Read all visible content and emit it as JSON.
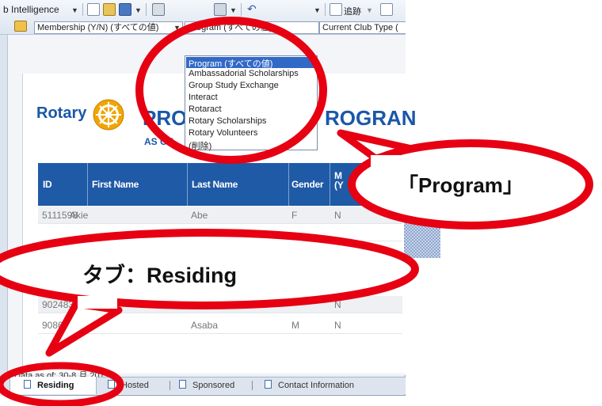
{
  "toolbar": {
    "app_menu_label": "b Intelligence",
    "track_label": "追跡",
    "filters": {
      "membership": "Membership (Y/N) (すべての値)",
      "program": "Program (すべての値)",
      "club_type": "Current Club Type ("
    }
  },
  "dropdown": {
    "options": [
      "Program (すべての値)",
      "Ambassadorial Scholarships",
      "Group Study Exchange",
      "Interact",
      "Rotaract",
      "Rotary Scholarships",
      "Rotary Volunteers",
      "(削除)"
    ],
    "selected_index": 0
  },
  "report": {
    "logo_text": "Rotary",
    "title_left": "PRO",
    "title_right": "ROGRAN",
    "subtitle_left": "AS OF",
    "columns": [
      "ID",
      "First Name",
      "Last Name",
      "Gender",
      "M (Y"
    ],
    "rows": [
      [
        "5111598",
        "Akie",
        "Abe",
        "F",
        "N"
      ],
      [
        "9024833",
        "",
        "",
        "",
        "N"
      ],
      [
        "90867",
        "",
        "Asaba",
        "M",
        "N"
      ]
    ],
    "data_as_of": "Data as of: 30-8 月 2015"
  },
  "tabs": [
    {
      "label": "Residing",
      "active": true
    },
    {
      "label": "Hosted",
      "active": false
    },
    {
      "label": "Sponsored",
      "active": false
    },
    {
      "label": "Contact Information",
      "active": false
    }
  ],
  "callouts": {
    "program": "「Program」",
    "tab": "タブ：Residing"
  },
  "colors": {
    "highlight_red": "#e60012",
    "table_header_blue": "#1f5aa6",
    "logo_blue": "#1a57a8",
    "logo_gold": "#f0a500",
    "selection_blue": "#3169c6"
  }
}
